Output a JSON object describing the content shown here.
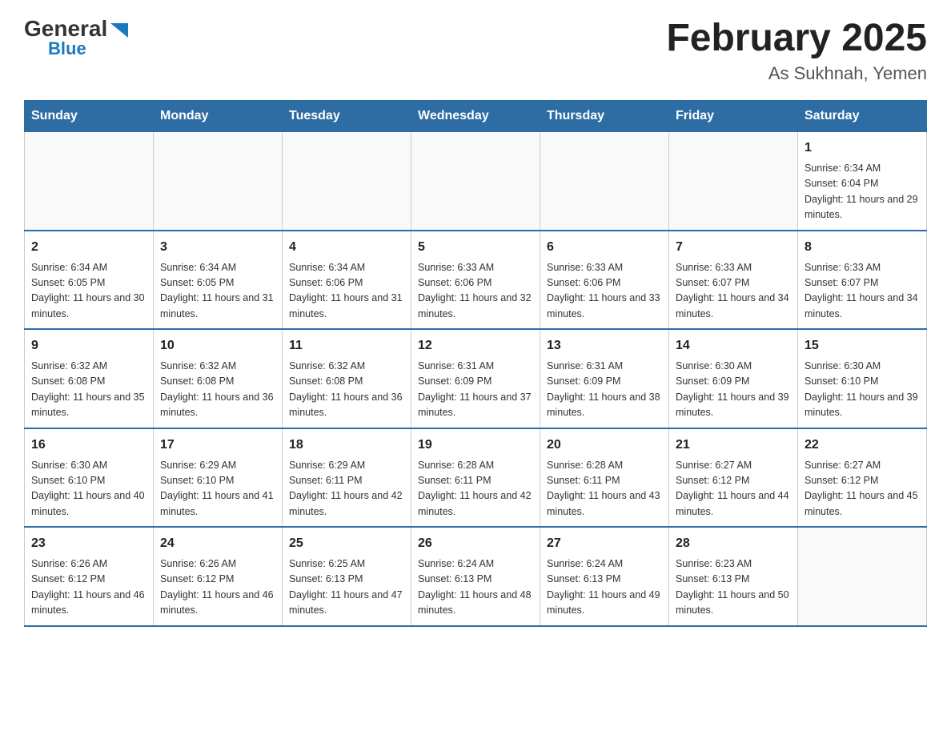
{
  "header": {
    "logo_general": "General",
    "logo_blue": "Blue",
    "month_title": "February 2025",
    "location": "As Sukhnah, Yemen"
  },
  "days_of_week": [
    "Sunday",
    "Monday",
    "Tuesday",
    "Wednesday",
    "Thursday",
    "Friday",
    "Saturday"
  ],
  "weeks": [
    [
      {
        "day": "",
        "info": ""
      },
      {
        "day": "",
        "info": ""
      },
      {
        "day": "",
        "info": ""
      },
      {
        "day": "",
        "info": ""
      },
      {
        "day": "",
        "info": ""
      },
      {
        "day": "",
        "info": ""
      },
      {
        "day": "1",
        "info": "Sunrise: 6:34 AM\nSunset: 6:04 PM\nDaylight: 11 hours and 29 minutes."
      }
    ],
    [
      {
        "day": "2",
        "info": "Sunrise: 6:34 AM\nSunset: 6:05 PM\nDaylight: 11 hours and 30 minutes."
      },
      {
        "day": "3",
        "info": "Sunrise: 6:34 AM\nSunset: 6:05 PM\nDaylight: 11 hours and 31 minutes."
      },
      {
        "day": "4",
        "info": "Sunrise: 6:34 AM\nSunset: 6:06 PM\nDaylight: 11 hours and 31 minutes."
      },
      {
        "day": "5",
        "info": "Sunrise: 6:33 AM\nSunset: 6:06 PM\nDaylight: 11 hours and 32 minutes."
      },
      {
        "day": "6",
        "info": "Sunrise: 6:33 AM\nSunset: 6:06 PM\nDaylight: 11 hours and 33 minutes."
      },
      {
        "day": "7",
        "info": "Sunrise: 6:33 AM\nSunset: 6:07 PM\nDaylight: 11 hours and 34 minutes."
      },
      {
        "day": "8",
        "info": "Sunrise: 6:33 AM\nSunset: 6:07 PM\nDaylight: 11 hours and 34 minutes."
      }
    ],
    [
      {
        "day": "9",
        "info": "Sunrise: 6:32 AM\nSunset: 6:08 PM\nDaylight: 11 hours and 35 minutes."
      },
      {
        "day": "10",
        "info": "Sunrise: 6:32 AM\nSunset: 6:08 PM\nDaylight: 11 hours and 36 minutes."
      },
      {
        "day": "11",
        "info": "Sunrise: 6:32 AM\nSunset: 6:08 PM\nDaylight: 11 hours and 36 minutes."
      },
      {
        "day": "12",
        "info": "Sunrise: 6:31 AM\nSunset: 6:09 PM\nDaylight: 11 hours and 37 minutes."
      },
      {
        "day": "13",
        "info": "Sunrise: 6:31 AM\nSunset: 6:09 PM\nDaylight: 11 hours and 38 minutes."
      },
      {
        "day": "14",
        "info": "Sunrise: 6:30 AM\nSunset: 6:09 PM\nDaylight: 11 hours and 39 minutes."
      },
      {
        "day": "15",
        "info": "Sunrise: 6:30 AM\nSunset: 6:10 PM\nDaylight: 11 hours and 39 minutes."
      }
    ],
    [
      {
        "day": "16",
        "info": "Sunrise: 6:30 AM\nSunset: 6:10 PM\nDaylight: 11 hours and 40 minutes."
      },
      {
        "day": "17",
        "info": "Sunrise: 6:29 AM\nSunset: 6:10 PM\nDaylight: 11 hours and 41 minutes."
      },
      {
        "day": "18",
        "info": "Sunrise: 6:29 AM\nSunset: 6:11 PM\nDaylight: 11 hours and 42 minutes."
      },
      {
        "day": "19",
        "info": "Sunrise: 6:28 AM\nSunset: 6:11 PM\nDaylight: 11 hours and 42 minutes."
      },
      {
        "day": "20",
        "info": "Sunrise: 6:28 AM\nSunset: 6:11 PM\nDaylight: 11 hours and 43 minutes."
      },
      {
        "day": "21",
        "info": "Sunrise: 6:27 AM\nSunset: 6:12 PM\nDaylight: 11 hours and 44 minutes."
      },
      {
        "day": "22",
        "info": "Sunrise: 6:27 AM\nSunset: 6:12 PM\nDaylight: 11 hours and 45 minutes."
      }
    ],
    [
      {
        "day": "23",
        "info": "Sunrise: 6:26 AM\nSunset: 6:12 PM\nDaylight: 11 hours and 46 minutes."
      },
      {
        "day": "24",
        "info": "Sunrise: 6:26 AM\nSunset: 6:12 PM\nDaylight: 11 hours and 46 minutes."
      },
      {
        "day": "25",
        "info": "Sunrise: 6:25 AM\nSunset: 6:13 PM\nDaylight: 11 hours and 47 minutes."
      },
      {
        "day": "26",
        "info": "Sunrise: 6:24 AM\nSunset: 6:13 PM\nDaylight: 11 hours and 48 minutes."
      },
      {
        "day": "27",
        "info": "Sunrise: 6:24 AM\nSunset: 6:13 PM\nDaylight: 11 hours and 49 minutes."
      },
      {
        "day": "28",
        "info": "Sunrise: 6:23 AM\nSunset: 6:13 PM\nDaylight: 11 hours and 50 minutes."
      },
      {
        "day": "",
        "info": ""
      }
    ]
  ]
}
